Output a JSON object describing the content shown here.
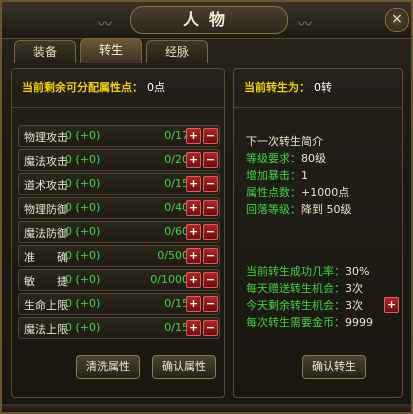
{
  "window": {
    "title": "人物",
    "close_label": "×"
  },
  "tabs": [
    {
      "label": "装备",
      "active": false
    },
    {
      "label": "转生",
      "active": true
    },
    {
      "label": "经脉",
      "active": false
    }
  ],
  "left_panel": {
    "header_label": "当前剩余可分配属性点：",
    "header_value": "0点",
    "attributes": [
      {
        "name": "物理攻击",
        "value": "0 (+0)",
        "max": "0/17"
      },
      {
        "name": "魔法攻击",
        "value": "0 (+0)",
        "max": "0/20"
      },
      {
        "name": "道术攻击",
        "value": "0 (+0)",
        "max": "0/15"
      },
      {
        "name": "物理防御",
        "value": "0 (+0)",
        "max": "0/40"
      },
      {
        "name": "魔法防御",
        "value": "0 (+0)",
        "max": "0/60"
      },
      {
        "name": "准　　确",
        "value": "0 (+0)",
        "max": "0/500"
      },
      {
        "name": "敏　　捷",
        "value": "0 (+0)",
        "max": "0/1000"
      },
      {
        "name": "生命上限",
        "value": "0 (+0)",
        "max": "0/15"
      },
      {
        "name": "魔法上限",
        "value": "0 (+0)",
        "max": "0/15"
      }
    ],
    "plus_label": "+",
    "minus_label": "−",
    "reset_button": "清洗属性",
    "confirm_button": "确认属性"
  },
  "right_panel": {
    "header_label": "当前转生为：",
    "header_value": "0转",
    "next_title": "下一次转生简介",
    "next_info": [
      {
        "label": "等级要求：",
        "value": "80级"
      },
      {
        "label": "增加暴击：",
        "value": "1"
      },
      {
        "label": "属性点数：",
        "value": "+1000点"
      },
      {
        "label": "回落等级：",
        "value": "降到 50级"
      }
    ],
    "stats": [
      {
        "label": "当前转生成功几率：",
        "value": "30%"
      },
      {
        "label": "每天赠送转生机会：",
        "value": "3次"
      },
      {
        "label": "今天剩余转生机会：",
        "value": "3次"
      },
      {
        "label": "每次转生需要金币：",
        "value": "9999"
      }
    ],
    "add_chance_label": "+",
    "confirm_button": "确认转生"
  },
  "colors": {
    "header_yellow": "#f0d000",
    "value_green": "#3fd43f",
    "button_red": "#b62222"
  }
}
